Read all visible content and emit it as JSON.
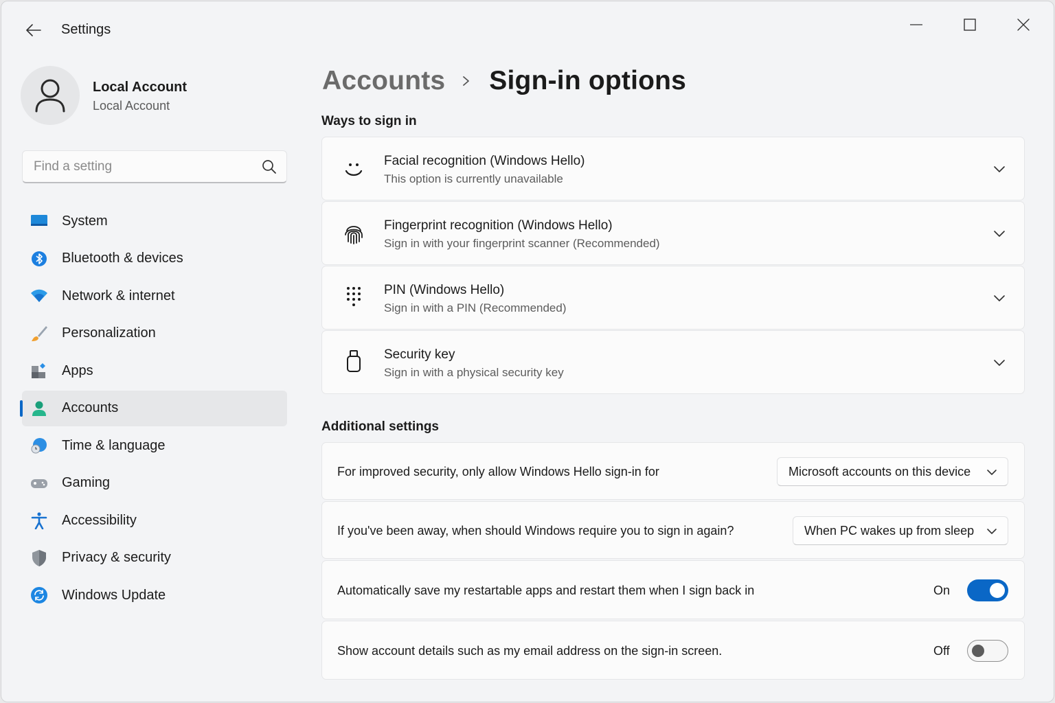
{
  "window": {
    "title": "Settings"
  },
  "profile": {
    "name": "Local Account",
    "type": "Local Account"
  },
  "search": {
    "placeholder": "Find a setting"
  },
  "sidebar": {
    "items": [
      {
        "label": "System",
        "icon": "system-icon",
        "active": false
      },
      {
        "label": "Bluetooth & devices",
        "icon": "bluetooth-icon",
        "active": false
      },
      {
        "label": "Network & internet",
        "icon": "wifi-icon",
        "active": false
      },
      {
        "label": "Personalization",
        "icon": "paintbrush-icon",
        "active": false
      },
      {
        "label": "Apps",
        "icon": "apps-icon",
        "active": false
      },
      {
        "label": "Accounts",
        "icon": "accounts-icon",
        "active": true
      },
      {
        "label": "Time & language",
        "icon": "globe-clock-icon",
        "active": false
      },
      {
        "label": "Gaming",
        "icon": "gamepad-icon",
        "active": false
      },
      {
        "label": "Accessibility",
        "icon": "accessibility-icon",
        "active": false
      },
      {
        "label": "Privacy & security",
        "icon": "shield-icon",
        "active": false
      },
      {
        "label": "Windows Update",
        "icon": "update-icon",
        "active": false
      }
    ]
  },
  "breadcrumb": {
    "parent": "Accounts",
    "current": "Sign-in options"
  },
  "ways": {
    "heading": "Ways to sign in",
    "items": [
      {
        "title": "Facial recognition (Windows Hello)",
        "desc": "This option is currently unavailable",
        "icon": "face-icon"
      },
      {
        "title": "Fingerprint recognition (Windows Hello)",
        "desc": "Sign in with your fingerprint scanner (Recommended)",
        "icon": "fingerprint-icon"
      },
      {
        "title": "PIN (Windows Hello)",
        "desc": "Sign in with a PIN (Recommended)",
        "icon": "pin-keypad-icon"
      },
      {
        "title": "Security key",
        "desc": "Sign in with a physical security key",
        "icon": "usb-key-icon"
      }
    ]
  },
  "additional": {
    "heading": "Additional settings",
    "hello_only": {
      "text": "For improved security, only allow Windows Hello sign-in for",
      "value": "Microsoft accounts on this device"
    },
    "require_signin": {
      "text": "If you've been away, when should Windows require you to sign in again?",
      "value": "When PC wakes up from sleep"
    },
    "restart_apps": {
      "text": "Automatically save my restartable apps and restart them when I sign back in",
      "state": "On",
      "checked": true
    },
    "account_details": {
      "text": "Show account details such as my email address on the sign-in screen.",
      "state": "Off",
      "checked": false
    }
  },
  "colors": {
    "accent": "#0a67c6",
    "background": "#f3f4f6",
    "card": "#fbfbfb"
  }
}
